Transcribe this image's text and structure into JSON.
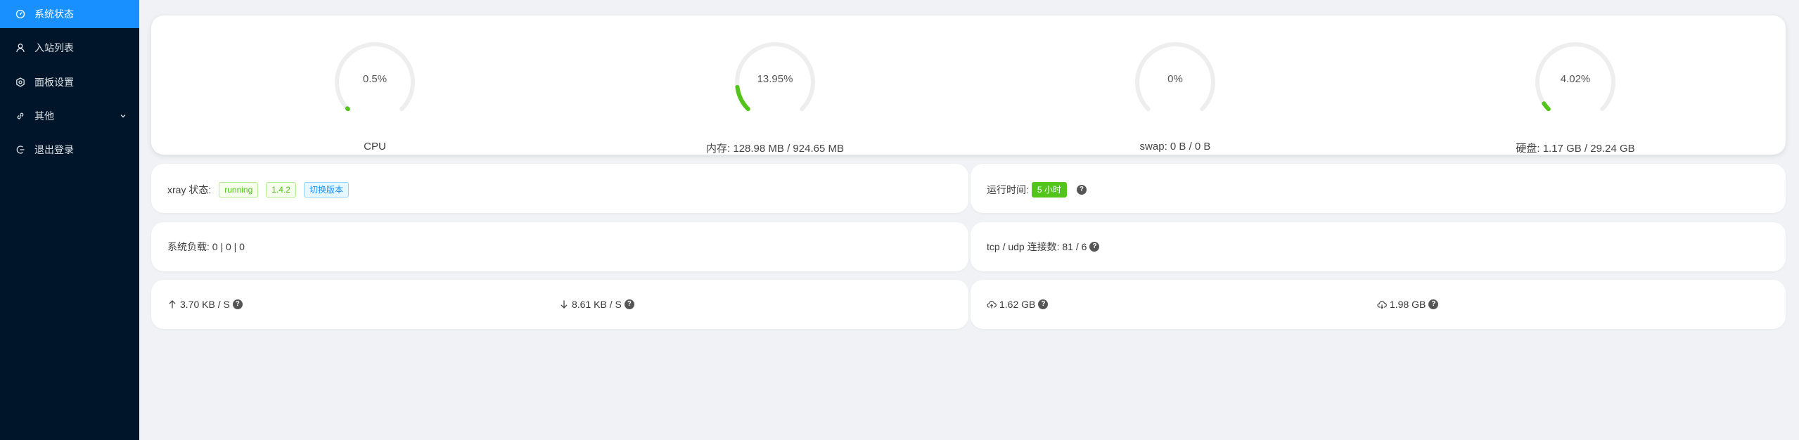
{
  "sidebar": {
    "items": [
      {
        "label": "系统状态",
        "icon": "dashboard-icon",
        "active": true
      },
      {
        "label": "入站列表",
        "icon": "user-icon"
      },
      {
        "label": "面板设置",
        "icon": "gear-icon"
      },
      {
        "label": "其他",
        "icon": "link-icon",
        "has_submenu": true
      },
      {
        "label": "退出登录",
        "icon": "logout-icon"
      }
    ]
  },
  "status": {
    "gauges": [
      {
        "value_text": "0.5%",
        "percent": 0.5,
        "label": "CPU"
      },
      {
        "value_text": "13.95%",
        "percent": 13.95,
        "label": "内存: 128.98 MB / 924.65 MB"
      },
      {
        "value_text": "0%",
        "percent": 0,
        "label": "swap: 0 B / 0 B"
      },
      {
        "value_text": "4.02%",
        "percent": 4.02,
        "label": "硬盘: 1.17 GB / 29.24 GB"
      }
    ],
    "xray": {
      "label": "xray 状态:",
      "state": "running",
      "version": "1.4.2",
      "switch_label": "切换版本"
    },
    "uptime": {
      "label": "运行时间:",
      "value": "5 小时"
    },
    "load": {
      "label": "系统负载:",
      "value": "0 | 0 | 0"
    },
    "connections": {
      "label": "tcp / udp 连接数:",
      "value": "81 / 6"
    },
    "traffic": {
      "upload_speed": "3.70 KB / S",
      "download_speed": "8.61 KB / S",
      "total_sent": "1.62 GB",
      "total_received": "1.98 GB"
    },
    "help_glyph": "?"
  },
  "colors": {
    "sidebar_bg": "#001529",
    "active_item_bg": "#1890ff",
    "gauge_fill": "#52c41a",
    "gauge_track": "#eeeeee",
    "page_bg": "#f0f2f5"
  }
}
